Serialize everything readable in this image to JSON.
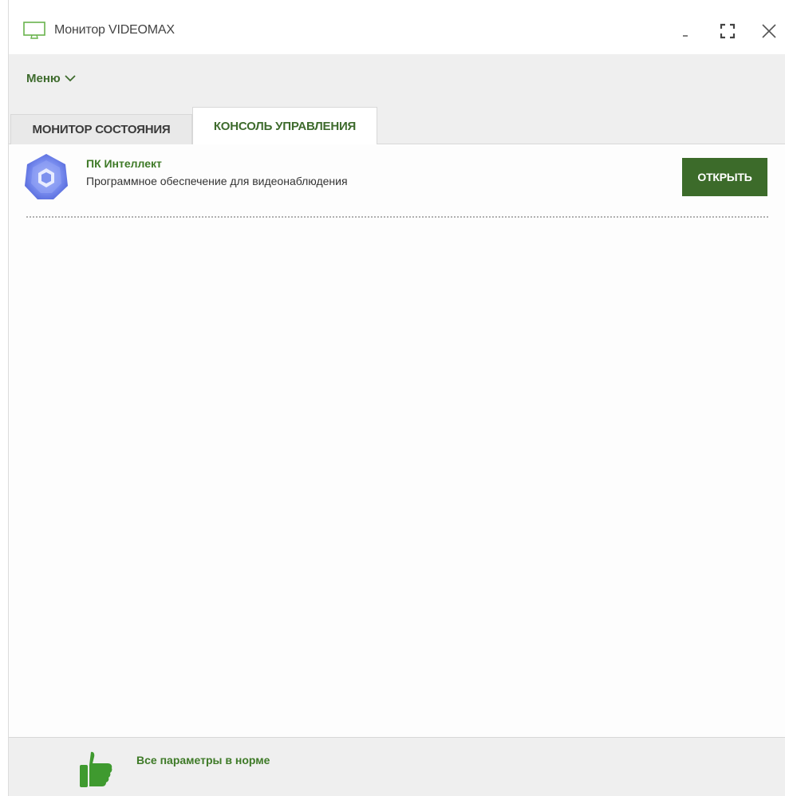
{
  "window": {
    "title": "Монитор VIDEOMAX",
    "app_icon": "monitor-icon",
    "controls": [
      "minimize-icon",
      "maximize-icon",
      "close-icon"
    ]
  },
  "menu": {
    "label": "Меню",
    "icon": "chevron-down-icon"
  },
  "tabs": [
    {
      "label": "МОНИТОР СОСТОЯНИЯ",
      "active": false
    },
    {
      "label": "КОНСОЛЬ УПРАВЛЕНИЯ",
      "active": true
    }
  ],
  "console": {
    "items": [
      {
        "icon": "intellect-logo-icon",
        "title": "ПК Интеллект",
        "description": "Программное обеспечение для видеонаблюдения",
        "action_label": "ОТКРЫТЬ"
      }
    ]
  },
  "status": {
    "icon": "thumbs-up-icon",
    "text": "Все параметры в норме"
  },
  "colors": {
    "accent": "#3e7a27",
    "button": "#3c6b2a",
    "logo": "#6f86e8"
  }
}
